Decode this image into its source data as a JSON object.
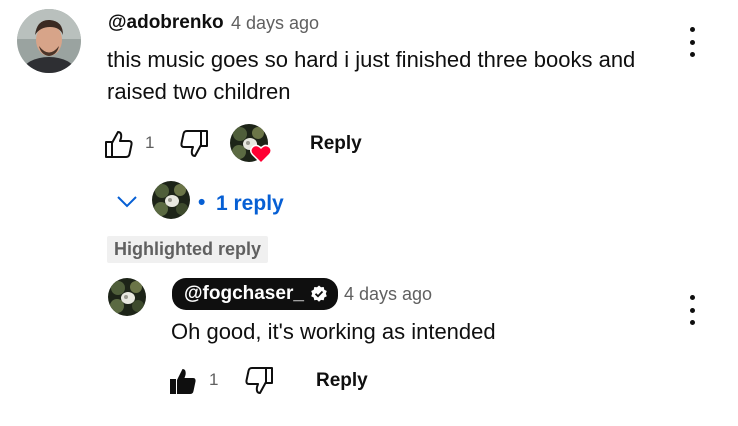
{
  "comment": {
    "author": "@adobrenko",
    "time": "4 days ago",
    "text_line1": "this music goes so hard i just finished three books and",
    "text_line2": "raised two children",
    "likes": "1",
    "reply_label": "Reply",
    "creator_heart": true
  },
  "replies_toggle": {
    "bullet": "•",
    "label": "1 reply"
  },
  "highlighted_label": "Highlighted reply",
  "reply": {
    "author": "@fogchaser_",
    "verified": true,
    "time": "4 days ago",
    "text": "Oh good, it's working as intended",
    "likes": "1",
    "liked": true,
    "reply_label": "Reply"
  },
  "colors": {
    "link_blue": "#065fd4",
    "heart_red": "#ff0033",
    "secondary_text": "#606060"
  },
  "icons": [
    "thumb-up-icon",
    "thumb-down-icon",
    "heart-icon",
    "chevron-down-icon",
    "more-vert-icon",
    "verified-check-icon"
  ]
}
